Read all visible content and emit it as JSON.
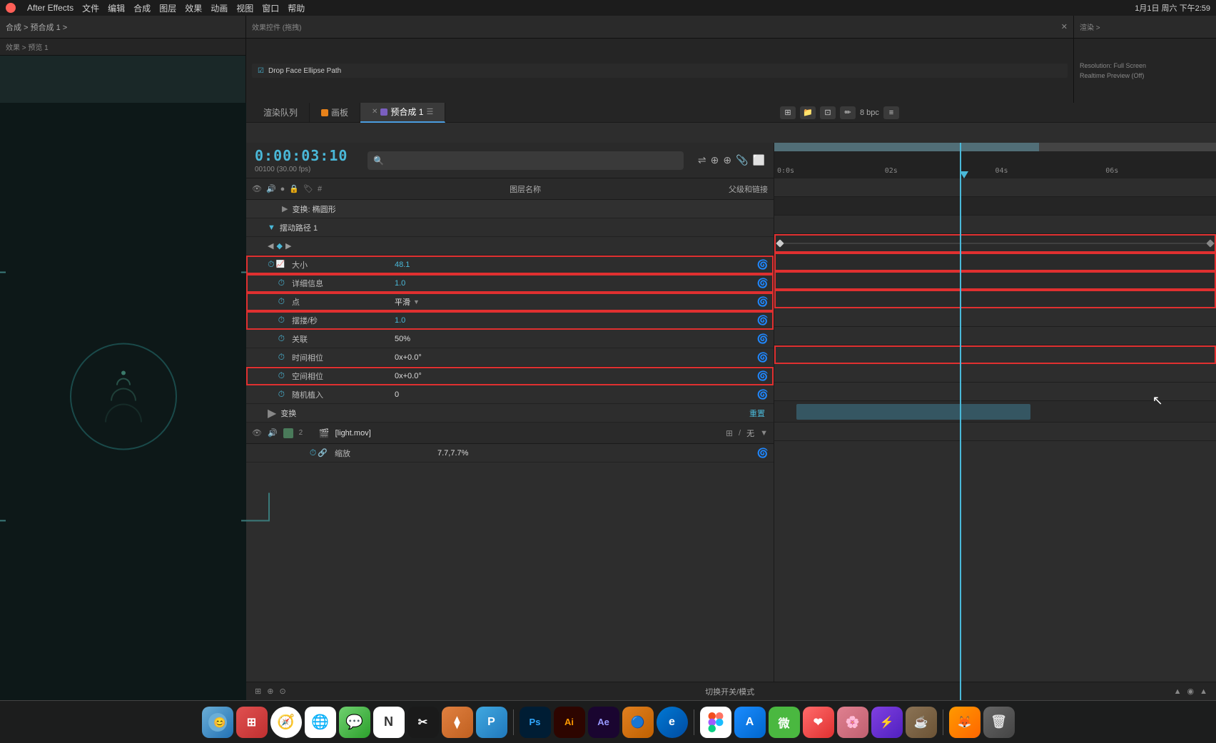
{
  "app": {
    "title": "After Effects - 预合成1",
    "menu_items": [
      "After Effects",
      "文件",
      "编辑",
      "合成",
      "图层",
      "效果",
      "动画",
      "视图",
      "窗口",
      "帮助"
    ]
  },
  "menubar": {
    "time": "1月1日 周六 下午2:59",
    "bpc_label": "8 bpc"
  },
  "tabs": {
    "render_queue": "渲染队列",
    "canvas": "画板",
    "precomp": "预合成 1"
  },
  "timecode": {
    "main": "0:00:03:10",
    "sub": "00100 (30.00 fps)"
  },
  "columns": {
    "layer_name": "图层名称",
    "parent_link": "父级和链接"
  },
  "sections": {
    "transform": "变换: 椭圆形",
    "wiggle": "摆动路径 1"
  },
  "properties": {
    "size": {
      "name": "大小",
      "value": "48.1"
    },
    "detail": {
      "name": "详细信息",
      "value": "1.0"
    },
    "point": {
      "name": "点",
      "value": "平滑"
    },
    "wobble_per_sec": {
      "name": "摆搂/秒",
      "value": "1.0"
    },
    "correlation": {
      "name": "关联",
      "value": "50%"
    },
    "temporal_phase": {
      "name": "时间相位",
      "value": "0x+0.0°"
    },
    "spatial_phase": {
      "name": "空间相位",
      "value": "0x+0.0°"
    },
    "random_seed": {
      "name": "随机植入",
      "value": "0"
    },
    "transform": {
      "name": "变换",
      "action": "重置"
    },
    "scale": {
      "name": "缩放",
      "value": "7.7,7.7%"
    }
  },
  "layers": {
    "layer2": {
      "number": "2",
      "name": "[light.mov]",
      "blend_mode": "无"
    }
  },
  "timeline": {
    "markers": [
      "0:0s",
      "02s",
      "04s",
      "06s"
    ],
    "playhead_position": "03:10"
  },
  "bottom_toolbar": {
    "label": "切换开关/模式"
  },
  "dock": {
    "items": [
      {
        "id": "finder",
        "label": "🔵",
        "bg": "#4a9de0"
      },
      {
        "id": "launchpad",
        "label": "🚀",
        "bg": "#e05050"
      },
      {
        "id": "safari",
        "label": "🧭",
        "bg": "#4ab8d8"
      },
      {
        "id": "chrome",
        "label": "Chrome",
        "bg": "#fff"
      },
      {
        "id": "messages",
        "label": "💬",
        "bg": "#4ab840"
      },
      {
        "id": "notion",
        "label": "N",
        "bg": "#fff"
      },
      {
        "id": "capcut",
        "label": "✂",
        "bg": "#1a1a1a"
      },
      {
        "id": "davinci",
        "label": "♦",
        "bg": "#e08040"
      },
      {
        "id": "pixelmator",
        "label": "P",
        "bg": "#40a8e0"
      },
      {
        "id": "ps",
        "label": "Ps",
        "bg": "#001d34"
      },
      {
        "id": "ai",
        "label": "Ai",
        "bg": "#2d0500"
      },
      {
        "id": "ae",
        "label": "Ae",
        "bg": "#1a0530"
      },
      {
        "id": "blender",
        "label": "🔵",
        "bg": "#e08020"
      },
      {
        "id": "edge",
        "label": "e",
        "bg": "#2a7abc"
      },
      {
        "id": "figma",
        "label": "Figma",
        "bg": "#fff"
      },
      {
        "id": "apple_store",
        "label": "🍎",
        "bg": "#4a9de0"
      },
      {
        "id": "wechat",
        "label": "微",
        "bg": "#4ab840"
      },
      {
        "id": "trash",
        "label": "🗑",
        "bg": "#555"
      }
    ]
  }
}
